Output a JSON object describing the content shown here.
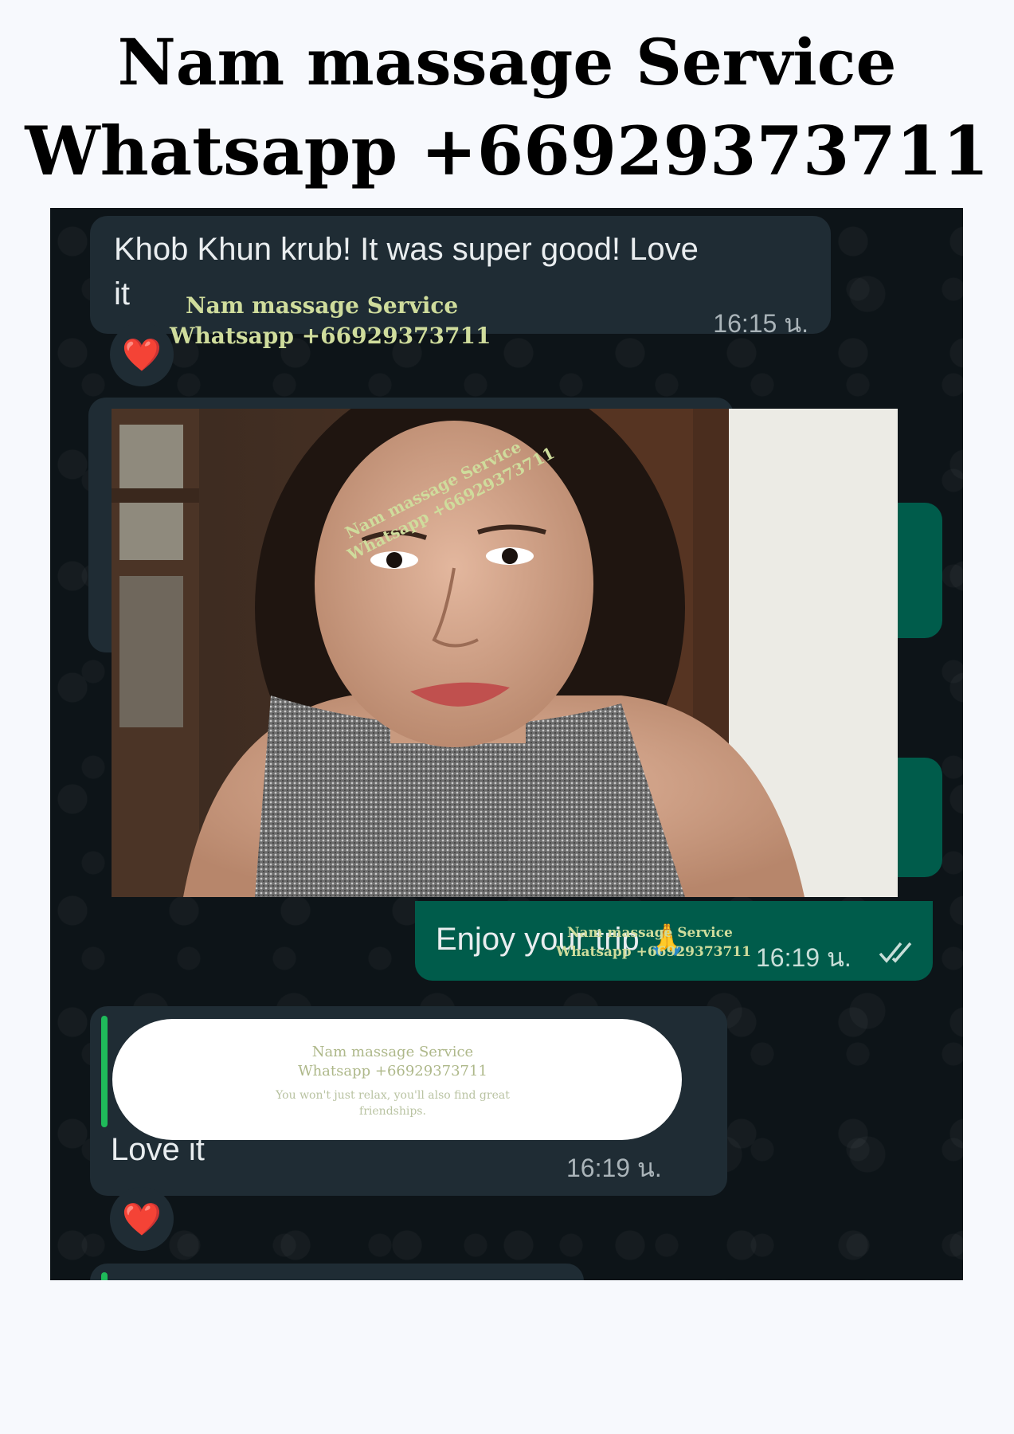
{
  "header": {
    "line1": "Nam massage Service",
    "line2": "Whatsapp +66929373711"
  },
  "watermark": {
    "line1": "Nam massage Service",
    "line2": "Whatsapp +66929373711",
    "tagline": "You won't just relax, you'll also find great friendships."
  },
  "messages": [
    {
      "direction": "incoming",
      "text_line1": "Khob Khun krub! It was super good! Love",
      "text_line2": "it",
      "time": "16:15 น.",
      "reaction": "❤️"
    },
    {
      "direction": "incoming",
      "type": "photo",
      "icon": "photo-portrait"
    },
    {
      "direction": "outgoing",
      "text": "Enjoy your trip",
      "emoji": "🙏",
      "time": "16:19 น.",
      "status": "read",
      "icon": "double-check-icon"
    },
    {
      "direction": "incoming",
      "type": "reply",
      "text": "Love it",
      "time": "16:19 น.",
      "reaction": "❤️"
    }
  ],
  "colors": {
    "page_bg": "#f7f9fd",
    "chat_bg": "#0d1418",
    "incoming_bubble": "#1f2c34",
    "outgoing_bubble": "#005c4b",
    "watermark": "#cfdc9c",
    "reply_bar": "#1fba5a"
  }
}
